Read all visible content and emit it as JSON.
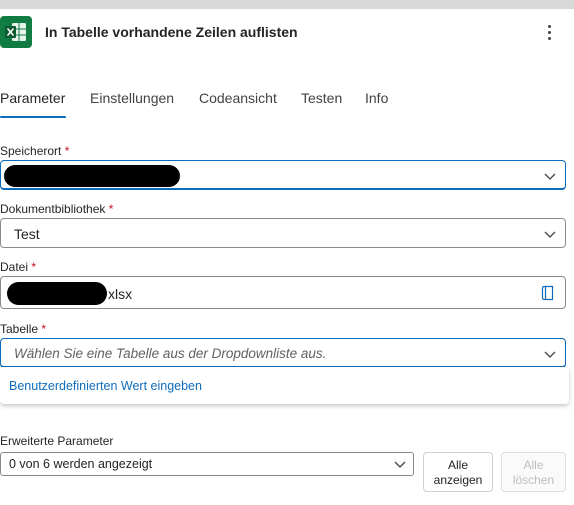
{
  "header": {
    "title": "In Tabelle vorhandene Zeilen auflisten",
    "app_icon": "excel-icon",
    "more_icon": "more-vertical-icon"
  },
  "tabs": [
    {
      "label": "Parameter",
      "active": true
    },
    {
      "label": "Einstellungen",
      "active": false
    },
    {
      "label": "Codeansicht",
      "active": false
    },
    {
      "label": "Testen",
      "active": false
    },
    {
      "label": "Info",
      "active": false
    }
  ],
  "fields": {
    "speicherort": {
      "label": "Speicherort",
      "required_mark": "*",
      "value": ""
    },
    "dokumentbibliothek": {
      "label": "Dokumentbibliothek",
      "required_mark": "*",
      "value": "Test"
    },
    "datei": {
      "label": "Datei",
      "required_mark": "*",
      "value_suffix": "xlsx"
    },
    "tabelle": {
      "label": "Tabelle",
      "required_mark": "*",
      "placeholder": "Wählen Sie eine Tabelle aus der Dropdownliste aus.",
      "dropdown_option": "Benutzerdefinierten Wert eingeben"
    }
  },
  "advanced": {
    "label": "Erweiterte Parameter",
    "select_value": "0 von 6 werden angezeigt",
    "show_all_line1": "Alle",
    "show_all_line2": "anzeigen",
    "clear_all_line1": "Alle",
    "clear_all_line2": "löschen"
  },
  "colors": {
    "accent": "#0f6cbd",
    "excel_green": "#107c41",
    "required": "#c50f1f"
  }
}
